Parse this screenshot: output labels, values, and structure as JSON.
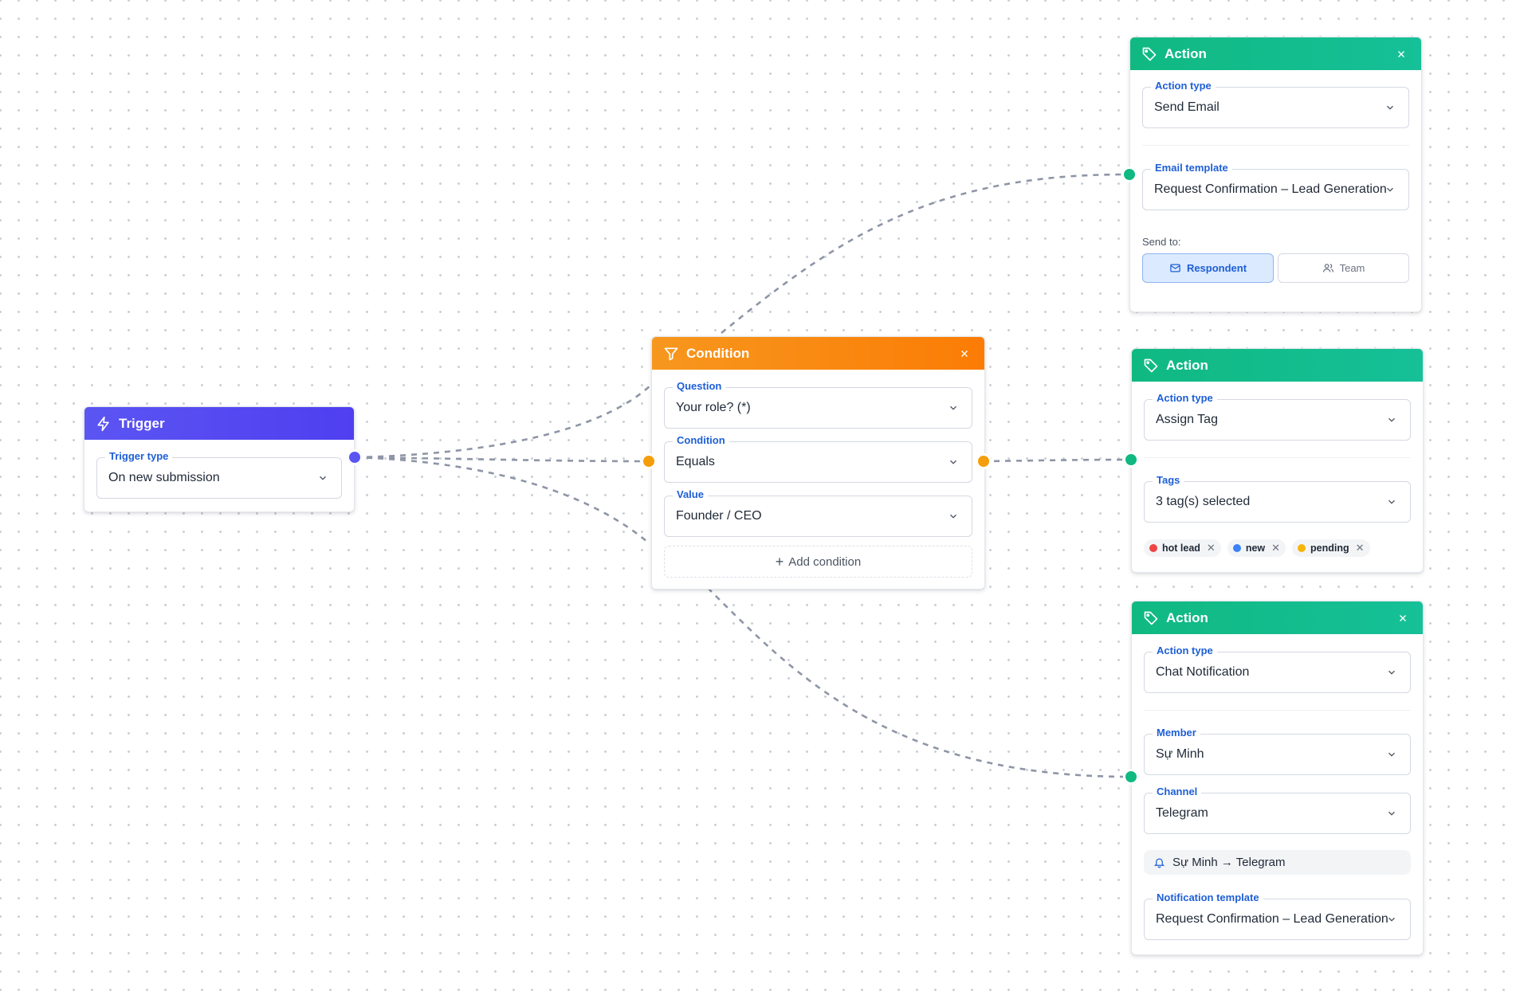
{
  "colors": {
    "trigger": "#5b55f2",
    "condition": "#fb8c05",
    "action": "#10b981",
    "label_blue": "#1e5fd6",
    "edge": "#8e95a6",
    "tag_hot_lead": "#ef4444",
    "tag_new": "#3b82f6",
    "tag_pending": "#f5b50a"
  },
  "trigger": {
    "title": "Trigger",
    "icon": "lightning-icon",
    "fields": {
      "trigger_type_label": "Trigger type",
      "trigger_type_value": "On new submission"
    }
  },
  "condition": {
    "title": "Condition",
    "icon": "filter-icon",
    "fields": {
      "question_label": "Question",
      "question_value": "Your role? (*)",
      "condition_label": "Condition",
      "condition_value": "Equals",
      "value_label": "Value",
      "value_value": "Founder / CEO"
    },
    "add_condition_label": "Add condition"
  },
  "action_email": {
    "title": "Action",
    "icon": "tag-icon",
    "action_type_label": "Action type",
    "action_type_value": "Send Email",
    "email_template_label": "Email template",
    "email_template_value": "Request Confirmation – Lead Generation",
    "send_to_label": "Send to:",
    "send_to_options": [
      {
        "label": "Respondent",
        "icon": "mail-icon",
        "selected": true
      },
      {
        "label": "Team",
        "icon": "users-icon",
        "selected": false
      }
    ]
  },
  "action_tag": {
    "title": "Action",
    "icon": "tag-icon",
    "action_type_label": "Action type",
    "action_type_value": "Assign Tag",
    "tags_label": "Tags",
    "tags_value": "3 tag(s) selected",
    "tags": [
      {
        "label": "hot lead",
        "color": "#ef4444"
      },
      {
        "label": "new",
        "color": "#3b82f6"
      },
      {
        "label": "pending",
        "color": "#f5b50a"
      }
    ]
  },
  "action_chat": {
    "title": "Action",
    "icon": "tag-icon",
    "action_type_label": "Action type",
    "action_type_value": "Chat Notification",
    "member_label": "Member",
    "member_value": "Sự Minh",
    "channel_label": "Channel",
    "channel_value": "Telegram",
    "summary": "Sự Minh → Telegram",
    "notification_template_label": "Notification template",
    "notification_template_value": "Request Confirmation – Lead Generation"
  }
}
